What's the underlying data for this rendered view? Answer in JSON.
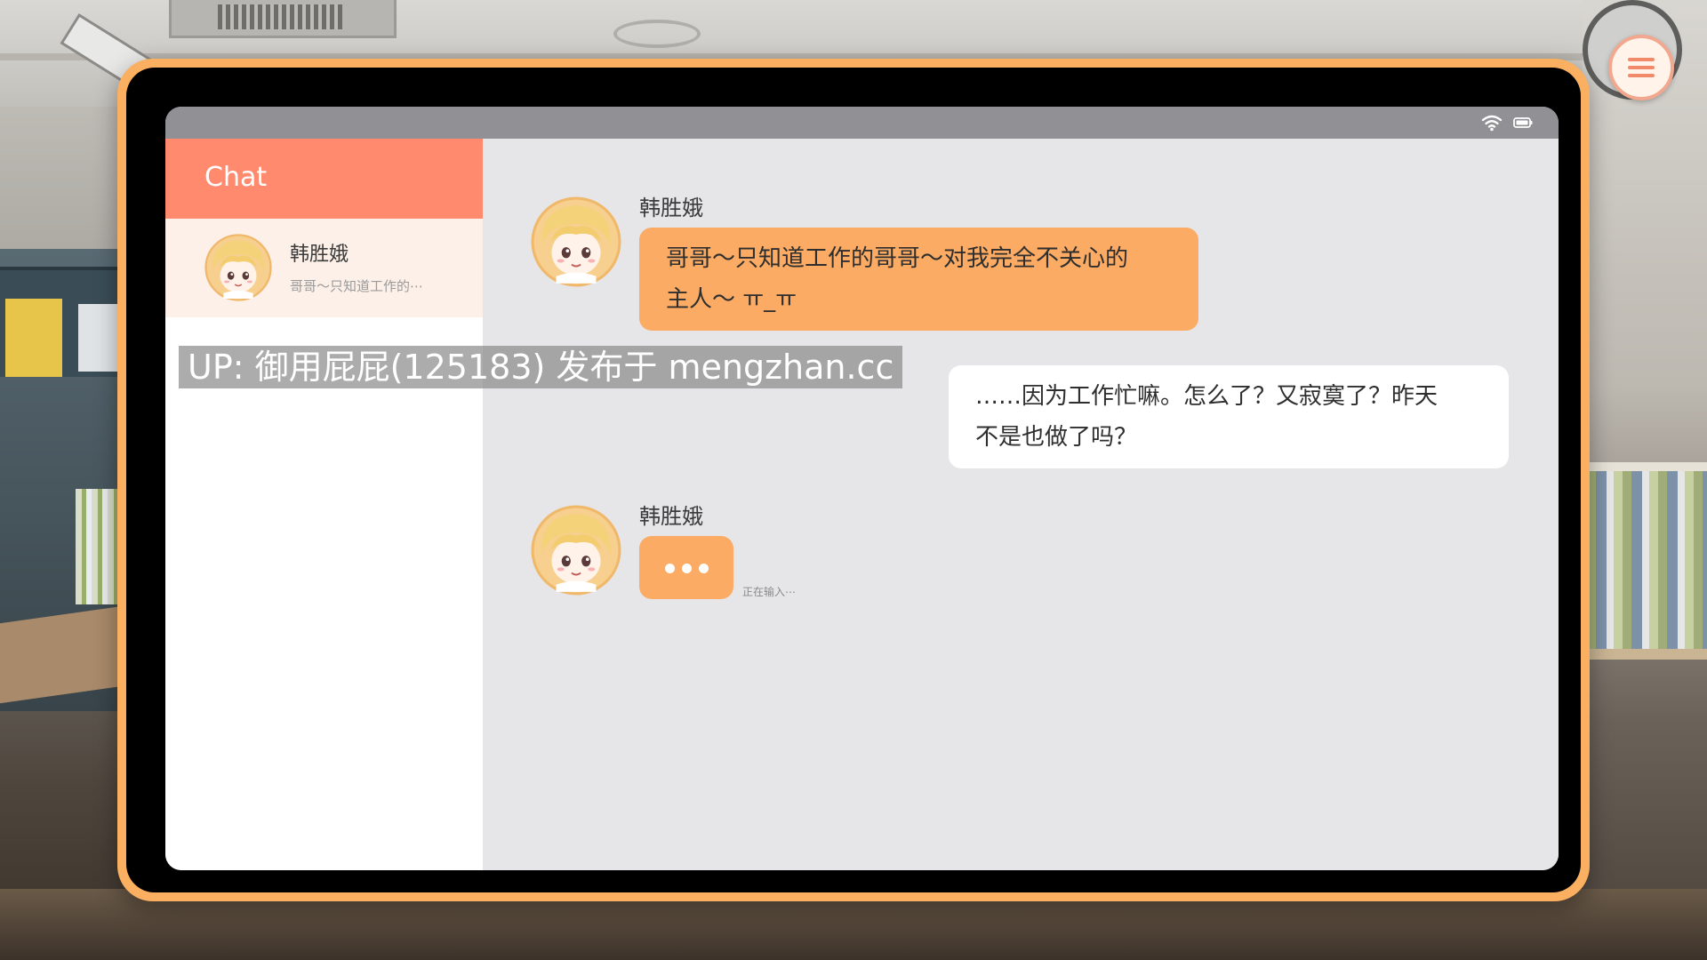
{
  "sidebar": {
    "title": "Chat",
    "contacts": [
      {
        "name": "韩胜娥",
        "preview": "哥哥～只知道工作的⋯",
        "avatar_icon": "character-avatar"
      }
    ]
  },
  "chat": {
    "messages": [
      {
        "direction": "incoming",
        "sender": "韩胜娥",
        "lines": [
          "哥哥～只知道工作的哥哥～对我完全不关心的",
          "主人～ ㅠ_ㅠ"
        ]
      },
      {
        "direction": "outgoing",
        "lines": [
          "……因为工作忙嘛。怎么了？又寂寞了？昨天",
          "不是也做了吗？"
        ]
      }
    ],
    "typing": {
      "sender": "韩胜娥",
      "status": "正在输入⋯"
    }
  },
  "status_bar": {
    "icons": [
      "wifi-icon",
      "battery-icon"
    ]
  },
  "watermark": "UP: 御用屁屁(125183) 发布于 mengzhan.cc",
  "menu_button": {
    "icon": "hamburger-menu-icon"
  },
  "colors": {
    "tablet_frame": "#fbb061",
    "sidebar_header": "#ff8a6e",
    "selected_contact": "#fdf0e8",
    "incoming_bubble": "#fbab63",
    "outgoing_bubble": "#ffffff",
    "chat_background": "#e6e6e8",
    "status_bar": "#919195"
  }
}
